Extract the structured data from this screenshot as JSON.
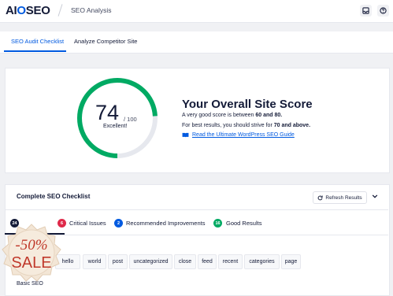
{
  "header": {
    "logo_prefix": "AI",
    "logo_o": "O",
    "logo_suffix": "SEO",
    "breadcrumb": "SEO Analysis",
    "icons": [
      "inbox-icon",
      "help-icon"
    ]
  },
  "tabs": [
    {
      "label": "SEO Audit Checklist",
      "active": true
    },
    {
      "label": "Analyze Competitor Site",
      "active": false
    }
  ],
  "score": {
    "value": "74",
    "max": "/ 100",
    "value_fraction": 0.74,
    "grade": "Excellent!",
    "title": "Your Overall Site Score",
    "line1_pre": "A very good score is between ",
    "line1_bold": "60 and 80.",
    "line2_pre": "For best results, you should strive for ",
    "line2_bold": "70 and above.",
    "guide_link": "Read the Ultimate WordPress SEO Guide",
    "accent": "#00aa63"
  },
  "checklist": {
    "title": "Complete SEO Checklist",
    "refresh_label": "Refresh Results",
    "status_tabs": [
      {
        "count": "24",
        "label": "",
        "color": "#141b38"
      },
      {
        "count": "6",
        "label": "Critical Issues",
        "color": "#df2a4a"
      },
      {
        "count": "2",
        "label": "Recommended Improvements",
        "color": "#005ae0"
      },
      {
        "count": "16",
        "label": "Good Results",
        "color": "#00aa63"
      }
    ],
    "keywords": [
      "hello",
      "world",
      "post",
      "uncategorized",
      "close",
      "feed",
      "recent",
      "categories",
      "page"
    ],
    "basic_label": "Basic SEO"
  },
  "promo": {
    "discount": "-50%",
    "label": "SALE"
  },
  "colors": {
    "brand": "#005ae0",
    "text": "#141b38",
    "critical": "#df2a4a",
    "good": "#00aa63",
    "background": "#f0f1f4"
  }
}
